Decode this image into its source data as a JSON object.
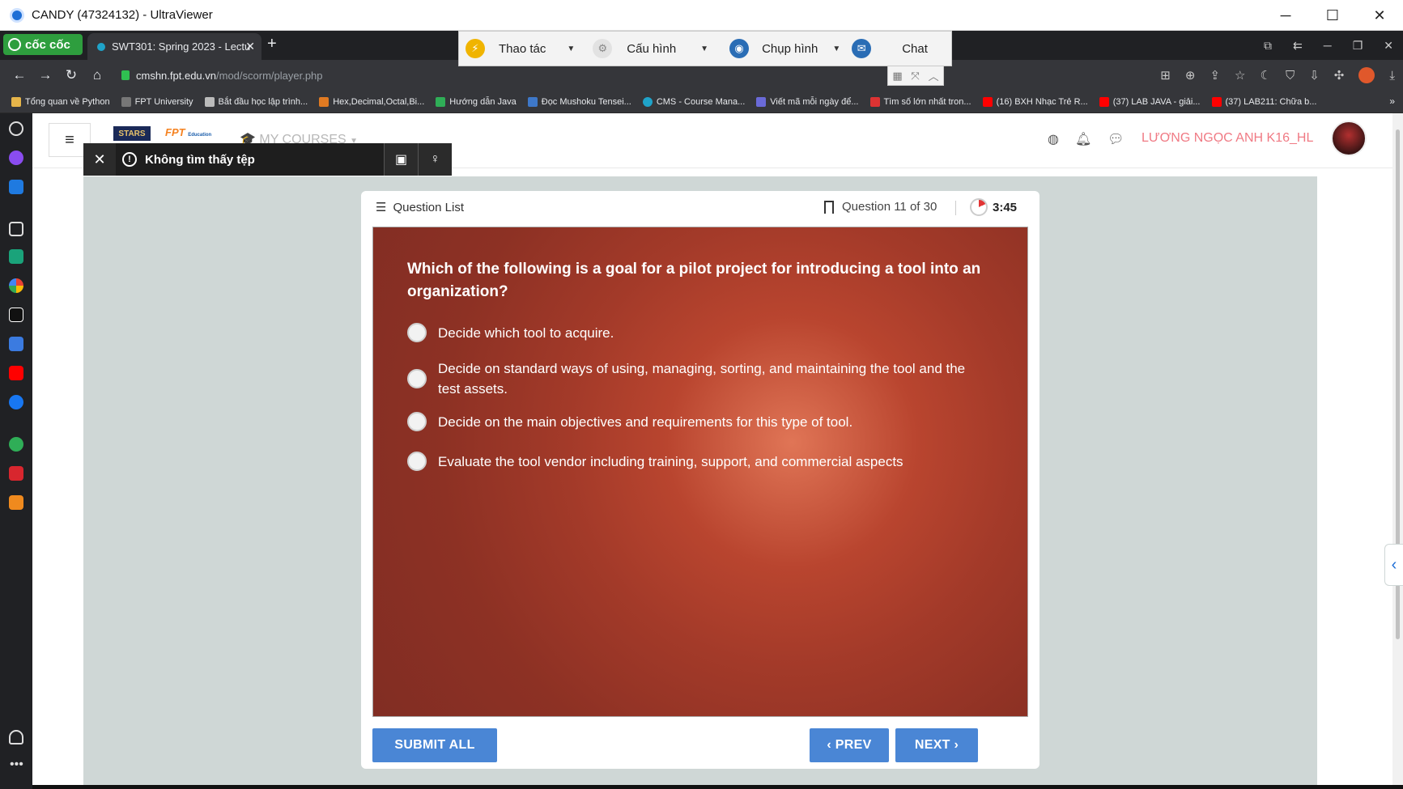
{
  "window": {
    "title": "CANDY (47324132) - UltraViewer"
  },
  "browser": {
    "brand": "cốc cốc",
    "tab_title": "SWT301: Spring 2023 - Lectu",
    "url_host": "cmshn.fpt.edu.vn",
    "url_path": "/mod/scorm/player.php",
    "bookmarks": [
      "Tổng quan về Python",
      "FPT University",
      "Bắt đầu học lập trình...",
      "Hex,Decimal,Octal,Bi...",
      "Hướng dẫn Java",
      "Đọc Mushoku Tensei...",
      "CMS - Course Mana...",
      "Viết mã mỗi ngày để...",
      "Tìm số lớn nhất tron...",
      "(16) BXH Nhạc Trẻ R...",
      "(37) LAB JAVA - giải...",
      "(37) LAB211: Chữa b..."
    ]
  },
  "ultraviewer": {
    "items": [
      "Thao tác",
      "Cấu hình",
      "Chụp hình",
      "Chat"
    ]
  },
  "lms": {
    "logo_text": "STARS",
    "logo_fpt": "FPT",
    "logo_fpt_sub": "Education",
    "nav_label": "MY COURSES",
    "username": "LƯƠNG NGỌC ANH K16_HL"
  },
  "notification": {
    "text": "Không tìm thấy tệp"
  },
  "quiz": {
    "question_list_label": "Question List",
    "position": "Question 11 of 30",
    "timer": "3:45",
    "question": "Which of the following is a goal for a pilot project for introducing a tool into an organization?",
    "options": [
      "Decide which tool to acquire.",
      "Decide on standard ways of using, managing, sorting, and maintaining the tool and the test assets.",
      "Decide on the main objectives and requirements for this type of tool.",
      "Evaluate the tool vendor including training, support, and commercial aspects"
    ],
    "submit_label": "SUBMIT ALL",
    "prev_label": "PREV",
    "next_label": "NEXT"
  }
}
